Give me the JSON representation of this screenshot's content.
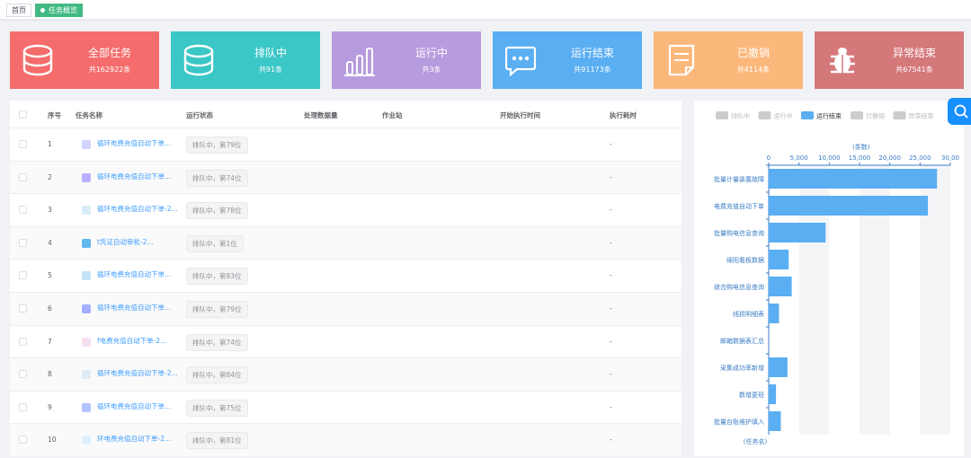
{
  "tabs": [
    {
      "label": "首页",
      "active": false
    },
    {
      "label": "任务概览",
      "active": true
    }
  ],
  "cards": [
    {
      "title": "全部任务",
      "count": "共162922条",
      "color": "#f56c6c",
      "icon": "database-icon"
    },
    {
      "title": "排队中",
      "count": "共91条",
      "color": "#3ac7c6",
      "icon": "database-icon"
    },
    {
      "title": "运行中",
      "count": "共3条",
      "color": "#b79bdf",
      "icon": "bar-chart-icon"
    },
    {
      "title": "运行结束",
      "count": "共91173条",
      "color": "#5aaef2",
      "icon": "message-icon"
    },
    {
      "title": "已撤销",
      "count": "共4114条",
      "color": "#fcb87b",
      "icon": "document-icon"
    },
    {
      "title": "异常结束",
      "count": "共67541条",
      "color": "#d5787a",
      "icon": "bug-icon"
    }
  ],
  "table": {
    "headers": [
      "序号",
      "任务名称",
      "运行状态",
      "处理数据量",
      "作业站",
      "开始执行时间",
      "执行耗时"
    ],
    "rows": [
      {
        "no": "1",
        "name": "循环电费充值自动下单...",
        "status": "排队中，第79位",
        "elapsed": "-"
      },
      {
        "no": "2",
        "name": "循环电费充值自动下单...",
        "status": "排队中，第74位",
        "elapsed": "-"
      },
      {
        "no": "3",
        "name": "循环电费充值自动下单-2...",
        "status": "排队中，第78位",
        "elapsed": "-"
      },
      {
        "no": "4",
        "name": "t凭证自动审批-2...",
        "status": "排队中，第1位",
        "elapsed": "-"
      },
      {
        "no": "5",
        "name": "循环电费充值自动下单...",
        "status": "排队中，第83位",
        "elapsed": "-"
      },
      {
        "no": "6",
        "name": "循环电费充值自动下单...",
        "status": "排队中，第79位",
        "elapsed": "-"
      },
      {
        "no": "7",
        "name": "f电费充值自动下单-2...",
        "status": "排队中，第74位",
        "elapsed": "-"
      },
      {
        "no": "8",
        "name": "循环电费充值自动下单-2...",
        "status": "排队中，第84位",
        "elapsed": "-"
      },
      {
        "no": "9",
        "name": "循环电费充值自动下单...",
        "status": "排队中，第75位",
        "elapsed": "-"
      },
      {
        "no": "10",
        "name": "环电费充值自动下单-2...",
        "status": "排队中，第81位",
        "elapsed": "-"
      }
    ]
  },
  "chart_data": {
    "type": "bar",
    "orientation": "horizontal",
    "legend": [
      {
        "name": "排队中",
        "active": false
      },
      {
        "name": "运行中",
        "active": false
      },
      {
        "name": "运行结束",
        "active": true
      },
      {
        "name": "已撤销",
        "active": false
      },
      {
        "name": "异常结束",
        "active": false
      }
    ],
    "xlabel": "(条数)",
    "ylabel": "(任务名)",
    "xlim": [
      0,
      30000
    ],
    "ticks": [
      "0",
      "5,000",
      "10,000",
      "15,000",
      "20,000",
      "25,000",
      "30,00"
    ],
    "tick_values": [
      0,
      5000,
      10000,
      15000,
      20000,
      25000,
      30000
    ],
    "categories": [
      "批量计量装置故障",
      "电费充值自动下单",
      "批量购电信息查询",
      "绵阳看板数据",
      "综合购电信息查询",
      "线损明细表",
      "邮箱数据表汇总",
      "采集成功率新增",
      "数增更班",
      "批量台账维护填入"
    ],
    "series": [
      {
        "name": "运行结束",
        "values": [
          27800,
          26300,
          9400,
          3300,
          3800,
          1700,
          0,
          3100,
          1200,
          2000
        ]
      }
    ],
    "bar_color": "#5aaef2",
    "legend_position": "top"
  }
}
